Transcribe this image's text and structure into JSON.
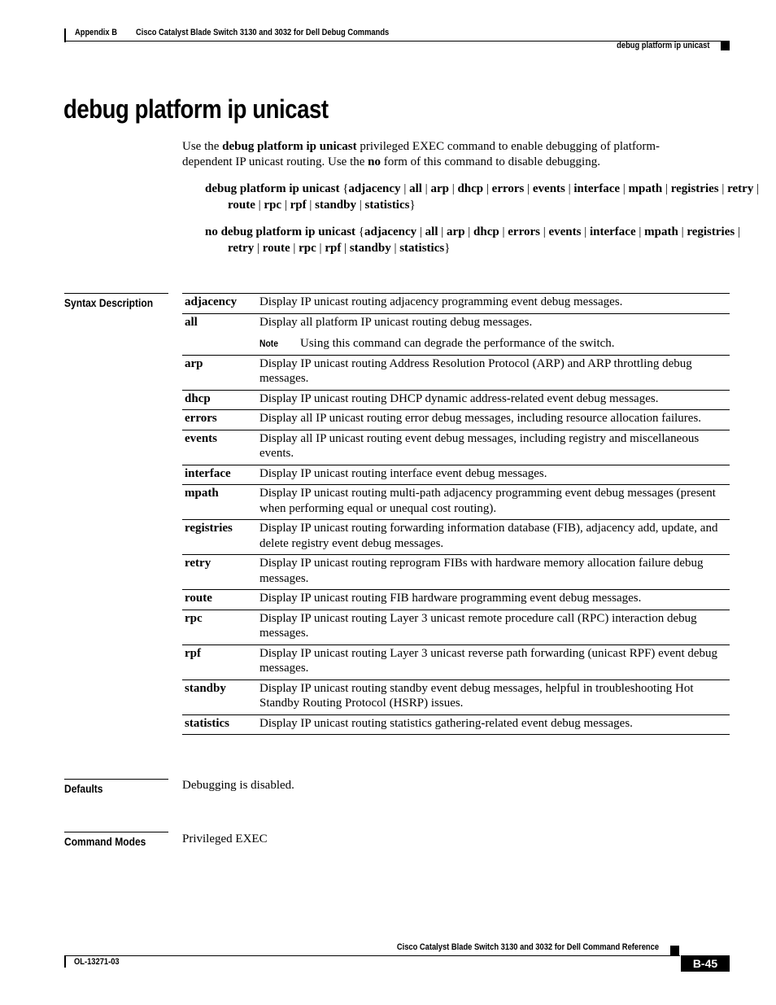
{
  "header": {
    "appendix": "Appendix B",
    "book_title": "Cisco Catalyst Blade Switch 3130 and 3032 for Dell Debug Commands",
    "command": "debug platform ip unicast"
  },
  "title": "debug platform ip unicast",
  "intro": {
    "p1": "Use the ",
    "cmd": "debug platform ip unicast",
    "p2": " privileged EXEC command to enable debugging of platform-dependent IP unicast routing. Use the ",
    "no": "no",
    "p3": " form of this command to disable debugging."
  },
  "syntax": {
    "cmd": "debug platform ip unicast",
    "no_cmd": "no debug platform ip unicast",
    "open": "{",
    "close": "}",
    "sep": " | ",
    "keywords": [
      "adjacency",
      "all",
      "arp",
      "dhcp",
      "errors",
      "events",
      "interface",
      "mpath",
      "registries",
      "retry",
      "route",
      "rpc",
      "rpf",
      "standby",
      "statistics"
    ]
  },
  "syntax_description": {
    "label": "Syntax Description",
    "rows": [
      {
        "keyword": "adjacency",
        "description": "Display IP unicast routing adjacency programming event debug messages."
      },
      {
        "keyword": "all",
        "description": "Display all platform IP unicast routing debug messages.",
        "note_label": "Note",
        "note": "Using this command can degrade the performance of the switch."
      },
      {
        "keyword": "arp",
        "description": "Display IP unicast routing Address Resolution Protocol (ARP) and ARP throttling debug messages."
      },
      {
        "keyword": "dhcp",
        "description": "Display IP unicast routing DHCP dynamic address-related event debug messages."
      },
      {
        "keyword": "errors",
        "description": "Display all IP unicast routing error debug messages, including resource allocation failures."
      },
      {
        "keyword": "events",
        "description": "Display all IP unicast routing event debug messages, including registry and miscellaneous events."
      },
      {
        "keyword": "interface",
        "description": "Display IP unicast routing interface event debug messages."
      },
      {
        "keyword": "mpath",
        "description": "Display IP unicast routing multi-path adjacency programming event debug messages (present when performing equal or unequal cost routing)."
      },
      {
        "keyword": "registries",
        "description": "Display IP unicast routing forwarding information database (FIB), adjacency add, update, and delete registry event debug messages."
      },
      {
        "keyword": "retry",
        "description": "Display IP unicast routing reprogram FIBs with hardware memory allocation failure debug messages."
      },
      {
        "keyword": "route",
        "description": "Display IP unicast routing FIB hardware programming event debug messages."
      },
      {
        "keyword": "rpc",
        "description": "Display IP unicast routing Layer 3 unicast remote procedure call (RPC) interaction debug messages."
      },
      {
        "keyword": "rpf",
        "description": "Display IP unicast routing Layer 3 unicast reverse path forwarding (unicast RPF) event debug messages."
      },
      {
        "keyword": "standby",
        "description": "Display IP unicast routing standby event debug messages, helpful in troubleshooting Hot Standby Routing Protocol (HSRP) issues."
      },
      {
        "keyword": "statistics",
        "description": "Display IP unicast routing statistics gathering-related event debug messages."
      }
    ]
  },
  "defaults": {
    "label": "Defaults",
    "text": "Debugging is disabled."
  },
  "command_modes": {
    "label": "Command Modes",
    "text": "Privileged EXEC"
  },
  "footer": {
    "reference_title": "Cisco Catalyst Blade Switch 3130 and 3032 for Dell Command Reference",
    "doc_number": "OL-13271-03",
    "page": "B-45"
  }
}
